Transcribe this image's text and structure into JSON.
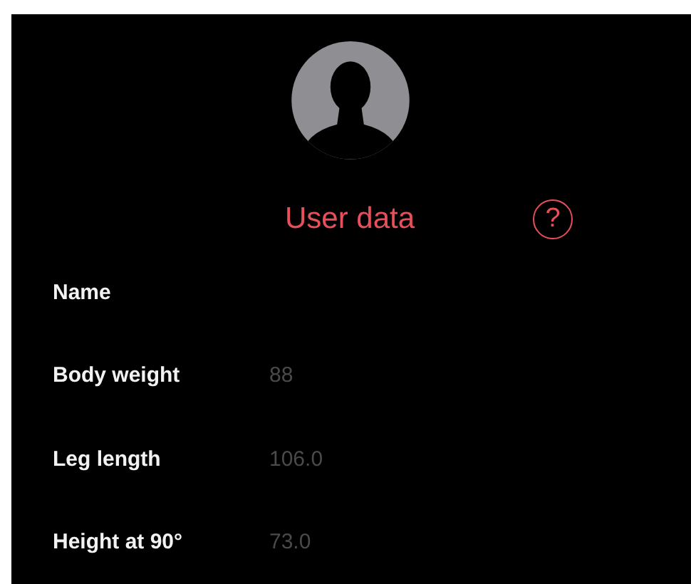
{
  "header": {
    "title": "User data",
    "help_icon": "?"
  },
  "fields": [
    {
      "label": "Name"
    },
    {
      "label": "Body weight",
      "value": "88"
    },
    {
      "label": "Leg length",
      "value": "106.0"
    },
    {
      "label": "Height at 90°",
      "value": "73.0"
    }
  ]
}
